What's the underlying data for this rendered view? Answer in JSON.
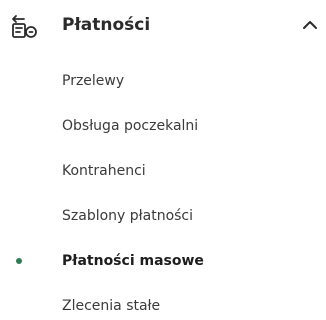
{
  "section": {
    "title": "Płatności",
    "icon": "payments-icon",
    "expanded": true
  },
  "items": [
    {
      "label": "Przelewy",
      "active": false
    },
    {
      "label": "Obsługa poczekalni",
      "active": false
    },
    {
      "label": "Kontrahenci",
      "active": false
    },
    {
      "label": "Szablony płatności",
      "active": false
    },
    {
      "label": "Płatności masowe",
      "active": true
    },
    {
      "label": "Zlecenia stałe",
      "active": false
    }
  ],
  "colors": {
    "active_dot": "#2e7d55",
    "text": "#3a3a3a",
    "title": "#2b2b2b"
  }
}
